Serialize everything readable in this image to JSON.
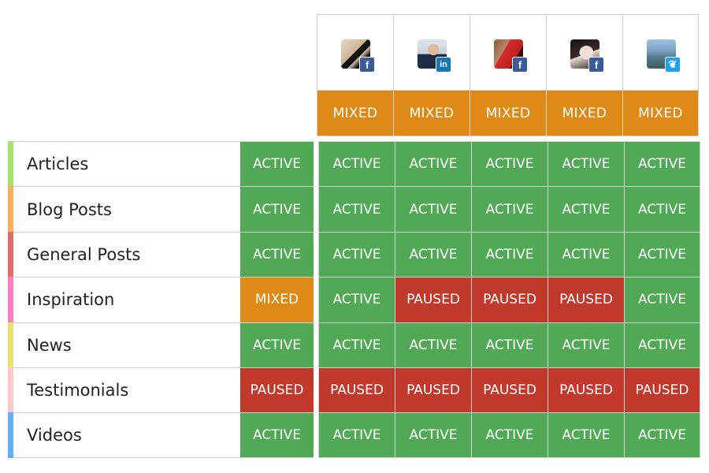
{
  "colors": {
    "active": "#52a955",
    "paused": "#c0392b",
    "mixed": "#df8916"
  },
  "accounts": [
    {
      "avatar": "person-silhouette-photo",
      "network": "facebook",
      "network_icon": "f",
      "status": "MIXED"
    },
    {
      "avatar": "man-in-suit-photo",
      "network": "linkedin",
      "network_icon": "in",
      "status": "MIXED"
    },
    {
      "avatar": "red-dress-photo",
      "network": "facebook",
      "network_icon": "f",
      "status": "MIXED"
    },
    {
      "avatar": "woman-portrait-photo",
      "network": "facebook",
      "network_icon": "f",
      "status": "MIXED"
    },
    {
      "avatar": "mountain-landscape-photo",
      "network": "twitter",
      "network_icon": "❦",
      "status": "MIXED"
    }
  ],
  "categories": [
    {
      "label": "Articles",
      "color": "#a6e36a",
      "overall": "ACTIVE",
      "statuses": [
        "ACTIVE",
        "ACTIVE",
        "ACTIVE",
        "ACTIVE",
        "ACTIVE"
      ]
    },
    {
      "label": "Blog Posts",
      "color": "#fbae5c",
      "overall": "ACTIVE",
      "statuses": [
        "ACTIVE",
        "ACTIVE",
        "ACTIVE",
        "ACTIVE",
        "ACTIVE"
      ]
    },
    {
      "label": "General Posts",
      "color": "#e56a6a",
      "overall": "ACTIVE",
      "statuses": [
        "ACTIVE",
        "ACTIVE",
        "ACTIVE",
        "ACTIVE",
        "ACTIVE"
      ]
    },
    {
      "label": "Inspiration",
      "color": "#fd7fc0",
      "overall": "MIXED",
      "statuses": [
        "ACTIVE",
        "PAUSED",
        "PAUSED",
        "PAUSED",
        "ACTIVE"
      ]
    },
    {
      "label": "News",
      "color": "#e6e66e",
      "overall": "ACTIVE",
      "statuses": [
        "ACTIVE",
        "ACTIVE",
        "ACTIVE",
        "ACTIVE",
        "ACTIVE"
      ]
    },
    {
      "label": "Testimonials",
      "color": "#fdcaca",
      "overall": "PAUSED",
      "statuses": [
        "PAUSED",
        "PAUSED",
        "PAUSED",
        "PAUSED",
        "PAUSED"
      ]
    },
    {
      "label": "Videos",
      "color": "#5fb0f8",
      "overall": "ACTIVE",
      "statuses": [
        "ACTIVE",
        "ACTIVE",
        "ACTIVE",
        "ACTIVE",
        "ACTIVE"
      ]
    }
  ]
}
